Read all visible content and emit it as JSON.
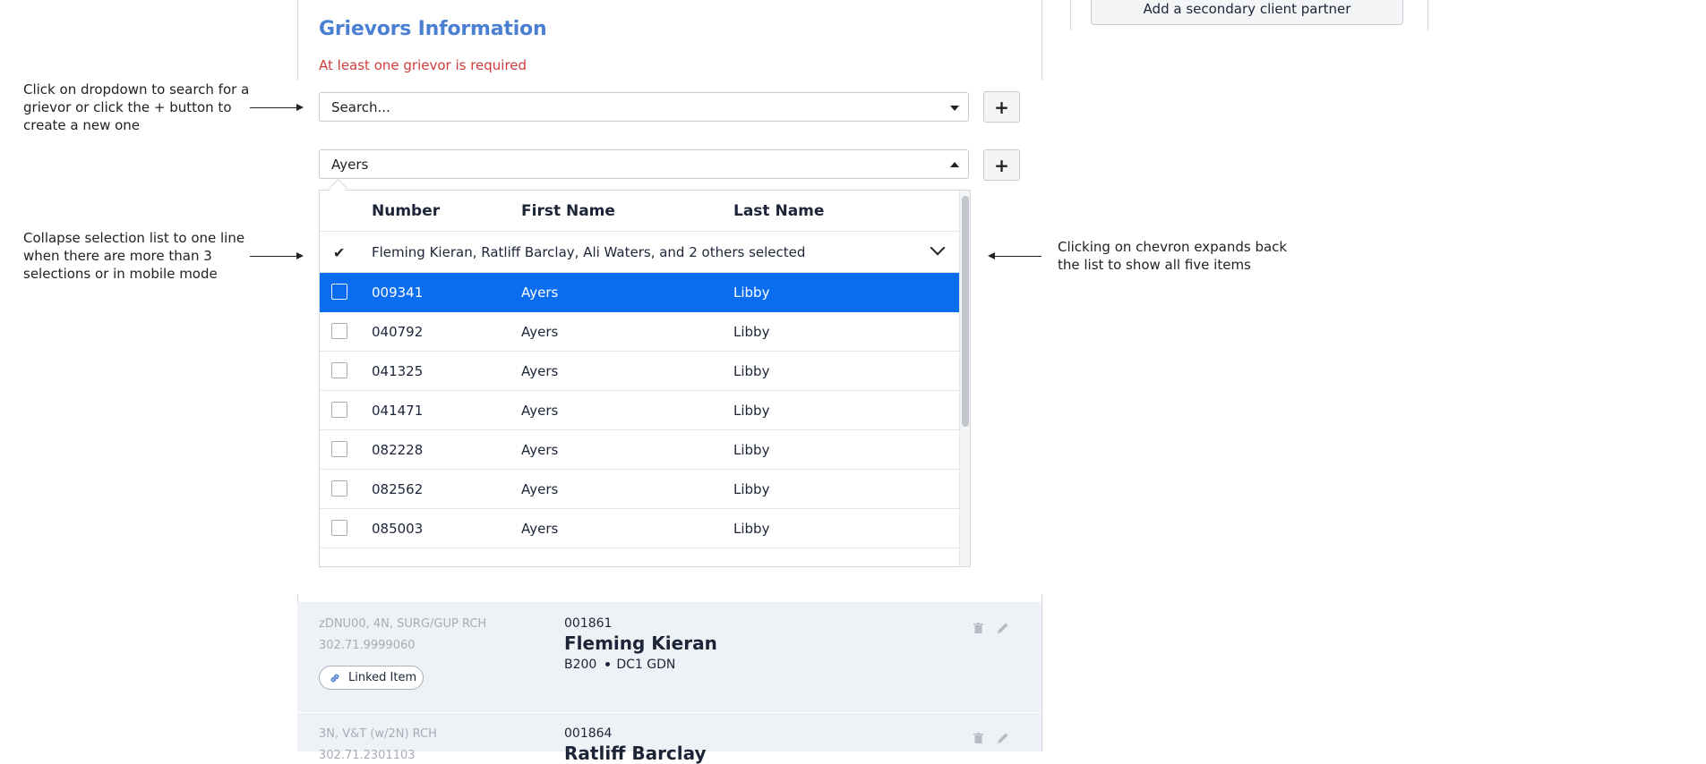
{
  "header": {
    "section_title": "Grievors Information",
    "error": "At least one grievor is required",
    "secondary_partner_button": "Add a secondary client partner"
  },
  "search_select": {
    "value": "Search...",
    "plus": "+"
  },
  "open_select": {
    "value": "Ayers",
    "plus": "+"
  },
  "dropdown": {
    "columns": [
      "Number",
      "First Name",
      "Last Name"
    ],
    "summary": "Fleming Kieran, Ratliff Barclay, Ali Waters, and 2 others selected",
    "rows": [
      {
        "number": "009341",
        "first": "Ayers",
        "last": "Libby",
        "highlighted": true
      },
      {
        "number": "040792",
        "first": "Ayers",
        "last": "Libby"
      },
      {
        "number": "041325",
        "first": "Ayers",
        "last": "Libby"
      },
      {
        "number": "041471",
        "first": "Ayers",
        "last": "Libby"
      },
      {
        "number": "082228",
        "first": "Ayers",
        "last": "Libby"
      },
      {
        "number": "082562",
        "first": "Ayers",
        "last": "Libby"
      },
      {
        "number": "085003",
        "first": "Ayers",
        "last": "Libby"
      }
    ],
    "highlight_color": "#0a6df0"
  },
  "notes": {
    "left1": [
      "Click on dropdown to search for a",
      "grievor or click the + button to",
      "create a new one"
    ],
    "left2": [
      "Collapse selection list to one line",
      "when there are more than 3",
      "selections or in mobile mode"
    ],
    "right": [
      "Clicking on chevron expands back",
      "the list to show all five items"
    ]
  },
  "cards": [
    {
      "location": "zDNU00, 4N, SURG/GUP RCH",
      "phone": "302.71.9999060",
      "number": "001861",
      "name": "Fleming Kieran",
      "code": "B200",
      "unit": "DC1 GDN",
      "linked": "Linked Item"
    },
    {
      "location": "3N, V&T (w/2N) RCH",
      "phone": "302.71.2301103",
      "number": "001864",
      "name": "Ratliff Barclay"
    }
  ],
  "icons": [
    "chevron-down-icon",
    "check-icon",
    "plus-icon",
    "trash-icon",
    "pencil-icon",
    "link-icon"
  ]
}
